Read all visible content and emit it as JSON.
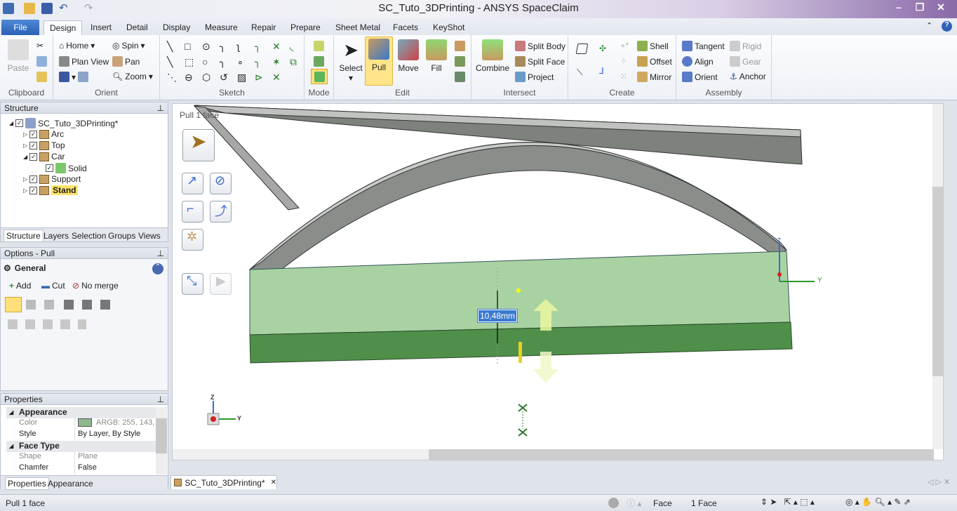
{
  "window": {
    "title": "SC_Tuto_3DPrinting - ANSYS SpaceClaim",
    "minimize": "–",
    "restore": "❐",
    "close": "✕"
  },
  "menu": {
    "file": "File",
    "tabs": [
      "Design",
      "Insert",
      "Detail",
      "Display",
      "Measure",
      "Repair",
      "Prepare",
      "Sheet Metal",
      "Facets",
      "KeyShot"
    ],
    "active": "Design"
  },
  "ribbon": {
    "clipboard": {
      "label": "Clipboard",
      "paste": "Paste"
    },
    "orient": {
      "label": "Orient",
      "home": "Home",
      "spin": "Spin",
      "plan_view": "Plan View",
      "pan": "Pan",
      "zoom": "Zoom"
    },
    "sketch": {
      "label": "Sketch"
    },
    "mode": {
      "label": "Mode"
    },
    "edit": {
      "label": "Edit",
      "select": "Select",
      "pull": "Pull",
      "move": "Move",
      "fill": "Fill"
    },
    "intersect": {
      "label": "Intersect",
      "combine": "Combine",
      "split_body": "Split Body",
      "split_face": "Split Face",
      "project": "Project"
    },
    "create": {
      "label": "Create",
      "shell": "Shell",
      "offset": "Offset",
      "mirror": "Mirror"
    },
    "assembly": {
      "label": "Assembly",
      "tangent": "Tangent",
      "align": "Align",
      "orient": "Orient",
      "rigid": "Rigid",
      "gear": "Gear",
      "anchor": "Anchor"
    }
  },
  "structure": {
    "title": "Structure",
    "root": "SC_Tuto_3DPrinting*",
    "items": [
      {
        "label": "Arc",
        "checked": true
      },
      {
        "label": "Top",
        "checked": true
      },
      {
        "label": "Car",
        "checked": true,
        "expanded": true
      },
      {
        "label": "Solid",
        "checked": true,
        "child": true
      },
      {
        "label": "Support",
        "checked": true
      },
      {
        "label": "Stand",
        "checked": true,
        "selected": true
      }
    ],
    "tabs": [
      "Structure",
      "Layers",
      "Selection",
      "Groups",
      "Views"
    ]
  },
  "options": {
    "title": "Options - Pull",
    "section": "General",
    "add": "Add",
    "cut": "Cut",
    "no_merge": "No merge"
  },
  "properties": {
    "title": "Properties",
    "groups": [
      {
        "name": "Appearance",
        "rows": [
          {
            "key": "Color",
            "value": "ARGB: 255, 143,",
            "swatch": "#8fb88f"
          },
          {
            "key": "Style",
            "value": "By Layer, By Style"
          }
        ]
      },
      {
        "name": "Face Type",
        "rows": [
          {
            "key": "Shape",
            "value": "Plane"
          },
          {
            "key": "Chamfer",
            "value": "False"
          }
        ]
      }
    ],
    "tabs": [
      "Properties",
      "Appearance"
    ]
  },
  "viewport": {
    "hint": "Pull 1 face",
    "dimension": "10,48mm",
    "axes": {
      "z": "Z",
      "y": "Y"
    },
    "colors": {
      "face": "#a9d2a3",
      "selected_face": "#4f8f4a",
      "beam": "#8a8f8a"
    }
  },
  "document_tab": {
    "label": "SC_Tuto_3DPrinting*",
    "close": "✕"
  },
  "status": {
    "message": "Pull 1 face",
    "filter": "Face",
    "selection": "1 Face"
  }
}
